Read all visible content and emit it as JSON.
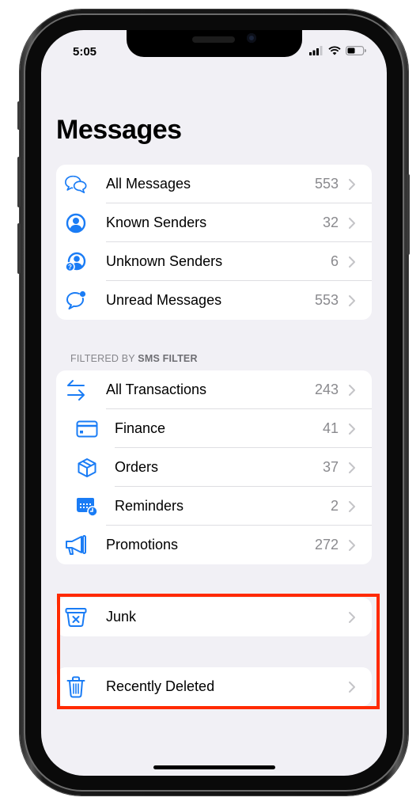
{
  "status_bar": {
    "time": "5:05",
    "icons": [
      "signal-icon",
      "wifi-icon",
      "battery-icon"
    ]
  },
  "page_title": "Messages",
  "colors": {
    "accent": "#1a7cf5",
    "background": "#f1f0f5",
    "highlight": "#ff2a00",
    "count": "#8a8a8e"
  },
  "group1": [
    {
      "label": "All Messages",
      "count": "553",
      "icon": "chat-bubbles-icon"
    },
    {
      "label": "Known Senders",
      "count": "32",
      "icon": "person-circle-icon"
    },
    {
      "label": "Unknown Senders",
      "count": "6",
      "icon": "person-question-icon"
    },
    {
      "label": "Unread Messages",
      "count": "553",
      "icon": "unread-bubble-icon"
    }
  ],
  "section_header": {
    "prefix": "FILTERED BY ",
    "bold": "SMS FILTER"
  },
  "group2": [
    {
      "label": "All Transactions",
      "count": "243",
      "icon": "arrows-left-right-icon"
    },
    {
      "label": "Finance",
      "count": "41",
      "icon": "credit-card-icon"
    },
    {
      "label": "Orders",
      "count": "37",
      "icon": "box-icon"
    },
    {
      "label": "Reminders",
      "count": "2",
      "icon": "calendar-clock-icon"
    },
    {
      "label": "Promotions",
      "count": "272",
      "icon": "megaphone-icon"
    }
  ],
  "junk": {
    "label": "Junk",
    "icon": "junk-bin-icon"
  },
  "recently_deleted": {
    "label": "Recently Deleted",
    "icon": "trash-icon"
  }
}
